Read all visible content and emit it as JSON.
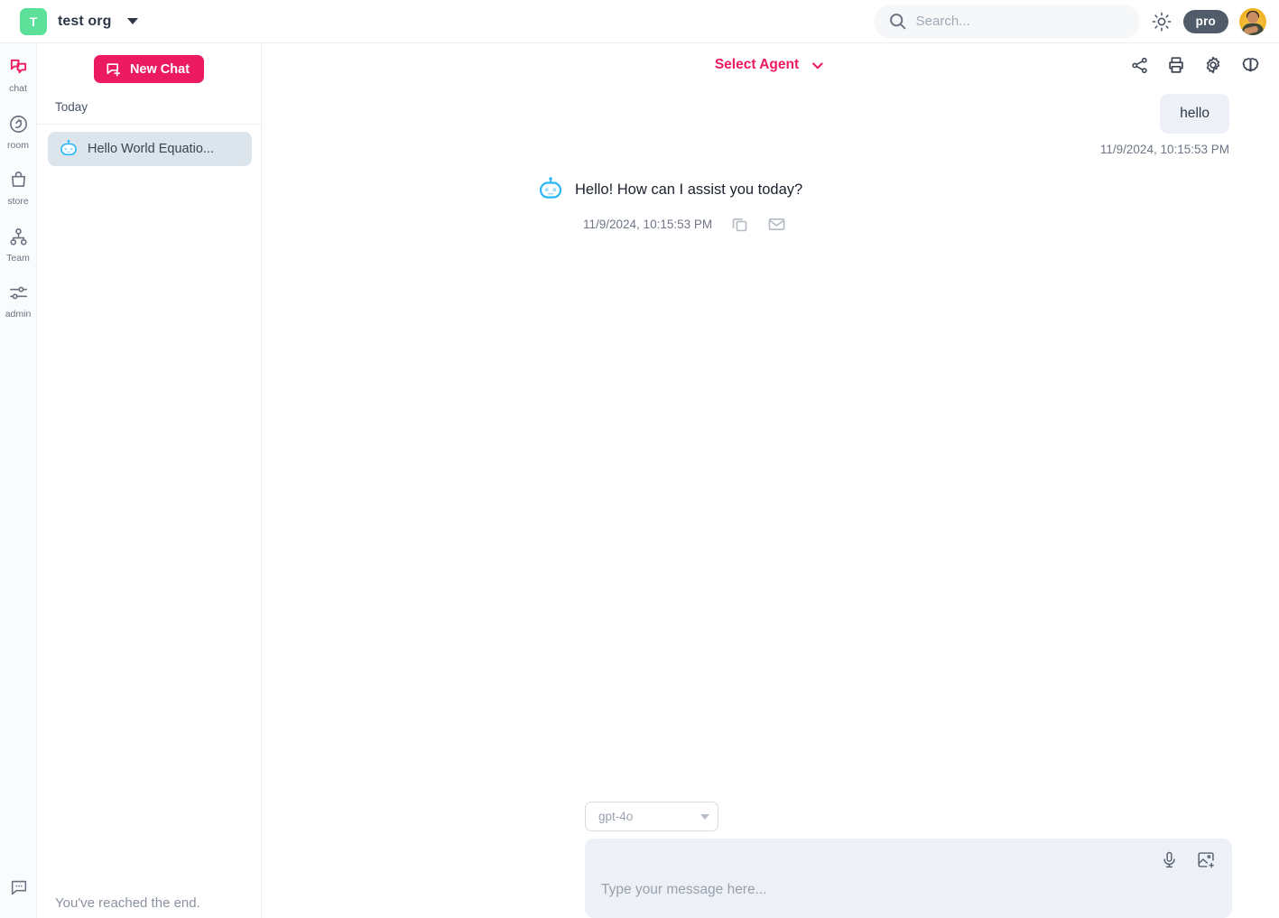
{
  "topbar": {
    "org_initial": "T",
    "org_name": "test org",
    "org_dropdown_icon": "caret-down-icon",
    "search": {
      "value": "",
      "placeholder": "Search..."
    },
    "search_icon": "search-icon",
    "theme_toggle_icon": "sun-icon",
    "pro_badge": "pro",
    "avatar_icon": "user-avatar",
    "accent_color": "#ec1a60",
    "org_avatar_color": "#5ce09a",
    "pro_badge_color": "#515c6b"
  },
  "rail": {
    "items": [
      {
        "label": "chat",
        "icon": "chat-icon",
        "active": true
      },
      {
        "label": "room",
        "icon": "room-icon",
        "active": false
      },
      {
        "label": "store",
        "icon": "store-icon",
        "active": false
      },
      {
        "label": "Team",
        "icon": "team-icon",
        "active": false
      },
      {
        "label": "admin",
        "icon": "sliders-icon",
        "active": false
      }
    ],
    "bottom_icon": "message-dots-icon"
  },
  "chatlist": {
    "new_chat_label": "New Chat",
    "new_chat_icon": "chat-plus-icon",
    "group_label": "Today",
    "conversations": [
      {
        "title": "Hello World Equatio...",
        "icon": "robot-icon",
        "selected": true
      }
    ],
    "end_note": "You've reached the end."
  },
  "main": {
    "agent_select_label": "Select Agent",
    "agent_select_icon": "chevron-down-icon",
    "head_icons": [
      {
        "name": "share-icon"
      },
      {
        "name": "print-icon"
      },
      {
        "name": "gear-icon"
      },
      {
        "name": "brain-icon"
      }
    ],
    "messages": [
      {
        "role": "user",
        "text": "hello",
        "timestamp": "11/9/2024, 10:15:53 PM"
      },
      {
        "role": "assistant",
        "text": "Hello! How can I assist you today?",
        "timestamp": "11/9/2024, 10:15:53 PM",
        "avatar_icon": "robot-icon",
        "actions": [
          {
            "name": "copy-icon"
          },
          {
            "name": "mail-icon"
          }
        ]
      }
    ],
    "composer": {
      "model": "gpt-4o",
      "model_caret_icon": "caret-down-icon",
      "input_value": "",
      "input_placeholder": "Type your message here...",
      "mic_icon": "microphone-icon",
      "image_icon": "image-plus-icon"
    }
  }
}
